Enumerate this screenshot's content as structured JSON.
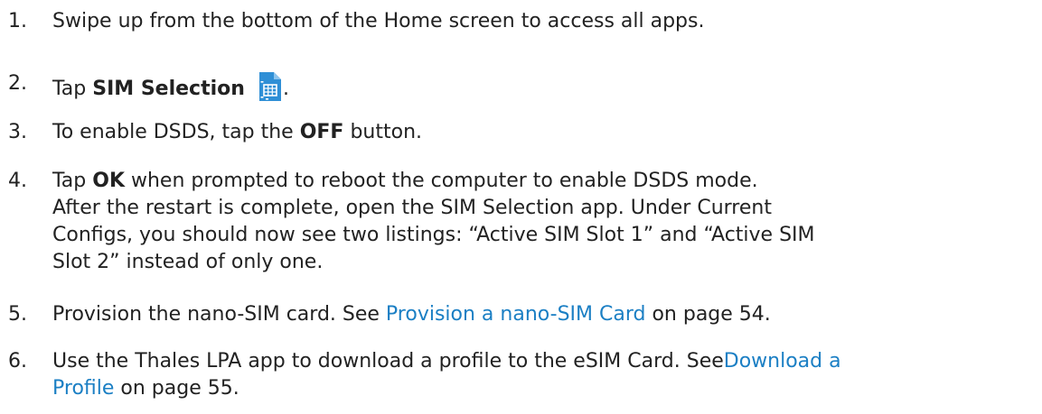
{
  "steps": [
    {
      "number": "1.",
      "text": "Swipe up from the bottom of the Home screen to access all apps."
    },
    {
      "number": "2.",
      "pre": "Tap ",
      "bold": "SIM Selection",
      "icon": "sim-card-icon",
      "post": "."
    },
    {
      "number": "3.",
      "pre": "To enable DSDS, tap the ",
      "bold": "OFF",
      "post": " button."
    },
    {
      "number": "4.",
      "pre": "Tap ",
      "bold": "OK",
      "post": " when prompted to reboot the computer to enable DSDS mode.",
      "lines": [
        "After the restart is complete, open the SIM Selection app. Under Current",
        "Configs, you should now see two listings: “Active SIM Slot 1” and “Active SIM",
        "Slot 2” instead of only one."
      ]
    },
    {
      "number": "5.",
      "pre": "Provision the nano-SIM card. See ",
      "link": "Provision a nano-SIM Card",
      "post": " on page 54."
    },
    {
      "number": "6.",
      "pre": "Use the Thales LPA app to download a profile to the eSIM Card. See",
      "link_a": "Download a",
      "link_b": "Profile",
      "post": " on page 55."
    }
  ],
  "colors": {
    "text": "#222222",
    "link": "#1b7fc4",
    "icon": "#2f8fd6"
  }
}
